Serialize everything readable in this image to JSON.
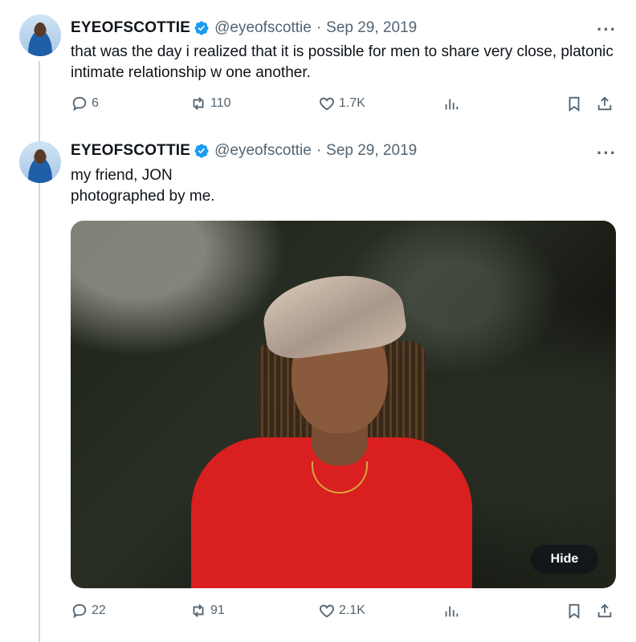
{
  "tweets": [
    {
      "name": "EYEOFSCOTTIE",
      "handle": "@eyeofscottie",
      "separator": "·",
      "date": "Sep 29, 2019",
      "more": "···",
      "text": "that was the day i realized that it is possible for men to share very close, platonic intimate relationship w one another.",
      "replies": "6",
      "retweets": "110",
      "likes": "1.7K"
    },
    {
      "name": "EYEOFSCOTTIE",
      "handle": "@eyeofscottie",
      "separator": "·",
      "date": "Sep 29, 2019",
      "more": "···",
      "text_line1": "my friend, JON",
      "text_line2": "photographed by me.",
      "hide_label": "Hide",
      "replies": "22",
      "retweets": "91",
      "likes": "2.1K"
    }
  ],
  "colors": {
    "verified": "#1d9bf0",
    "secondary": "#536471",
    "thread_line": "#cfd9de"
  },
  "icons": [
    "reply-icon",
    "retweet-icon",
    "like-icon",
    "views-icon",
    "bookmark-icon",
    "share-icon",
    "verified-icon",
    "more-icon"
  ]
}
